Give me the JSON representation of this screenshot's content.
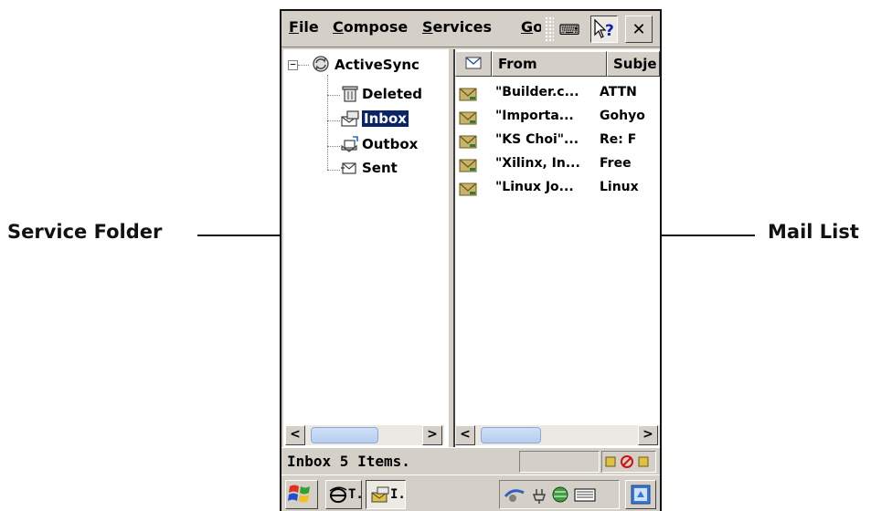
{
  "callouts": {
    "left_label": "Service Folder",
    "right_label": "Mail List"
  },
  "menubar": {
    "items": [
      {
        "accel": "F",
        "rest": "ile"
      },
      {
        "accel": "C",
        "rest": "ompose"
      },
      {
        "accel": "S",
        "rest": "ervices"
      },
      {
        "accel": "G",
        "rest": "o"
      }
    ],
    "buttons": [
      {
        "name": "input-panel-icon",
        "glyph": "⌨"
      },
      {
        "name": "help-icon",
        "glyph": "?"
      },
      {
        "name": "close-icon",
        "glyph": "✕"
      }
    ]
  },
  "folders": {
    "root": "ActiveSync",
    "root_expander": "⊟",
    "items": [
      "Deleted",
      "Inbox",
      "Outbox",
      "Sent"
    ],
    "selected": "Inbox"
  },
  "mail_list": {
    "columns": [
      "From",
      "Subje"
    ],
    "rows": [
      {
        "from": "\"Builder.c...",
        "subject": "ATTN"
      },
      {
        "from": "\"Importa...",
        "subject": "Gohyo"
      },
      {
        "from": "\"KS Choi\"...",
        "subject": "Re: F"
      },
      {
        "from": "\"Xilinx, In...",
        "subject": "Free"
      },
      {
        "from": "\"Linux Jo...",
        "subject": "Linux"
      }
    ]
  },
  "scroll": {
    "left_arrow": "<",
    "right_arrow": ">"
  },
  "status": {
    "text": "Inbox 5 Items."
  },
  "taskbar": {
    "task1_label": "T.",
    "task2_label": "I."
  },
  "colors": {
    "selection": "#0a246a",
    "chrome": "#d4d0c8",
    "envelope": "#c8b36a"
  }
}
